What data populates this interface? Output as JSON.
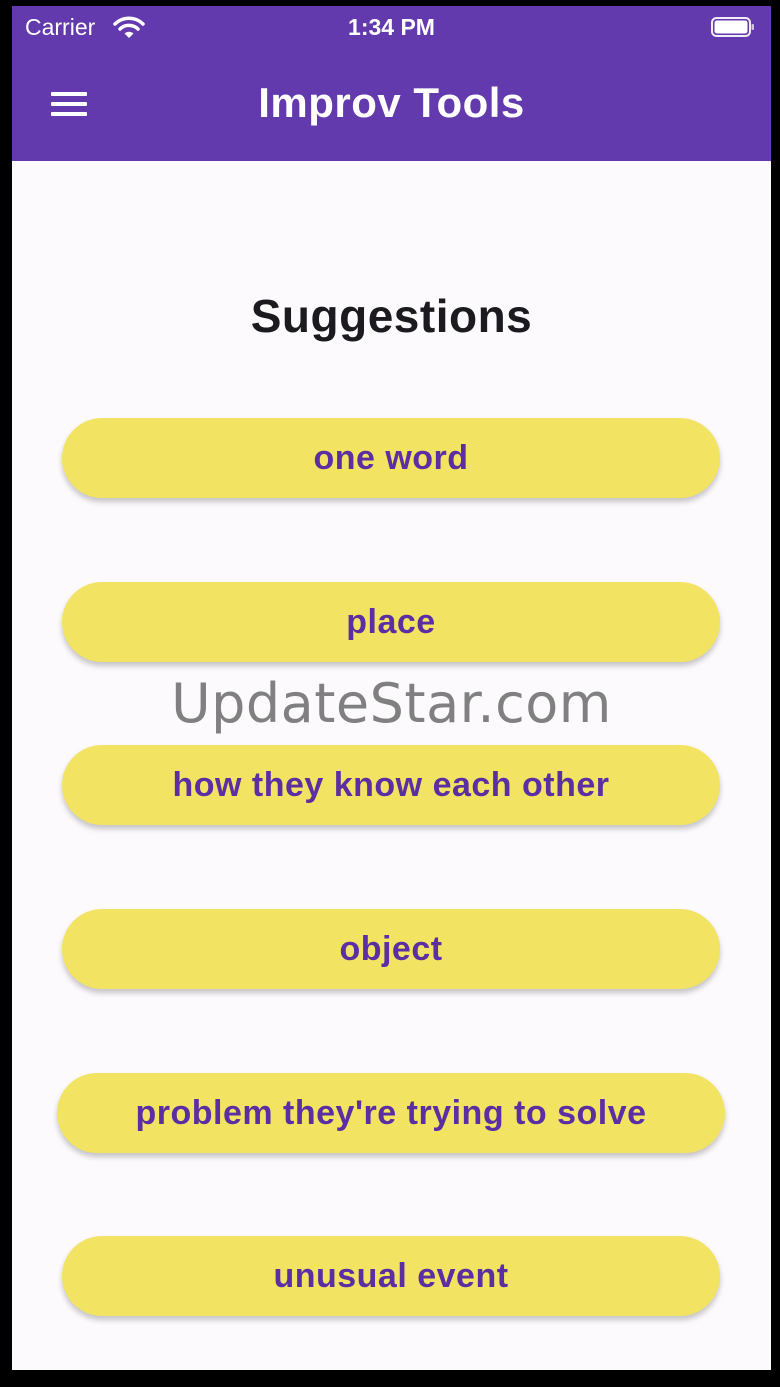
{
  "status_bar": {
    "carrier": "Carrier",
    "time": "1:34 PM",
    "wifi_icon": "wifi-icon",
    "battery_icon": "battery-icon"
  },
  "app_bar": {
    "title": "Improv Tools",
    "menu_icon": "hamburger-menu-icon",
    "color": "#6339ae"
  },
  "main": {
    "heading": "Suggestions",
    "buttons": [
      {
        "label": "one word"
      },
      {
        "label": "place"
      },
      {
        "label": "how they know each other"
      },
      {
        "label": "object"
      },
      {
        "label": "problem they're trying to solve"
      },
      {
        "label": "unusual event"
      }
    ],
    "button_color": "#f2e363",
    "button_text_color": "#5b2ea3"
  },
  "watermark": "UpdateStar.com"
}
